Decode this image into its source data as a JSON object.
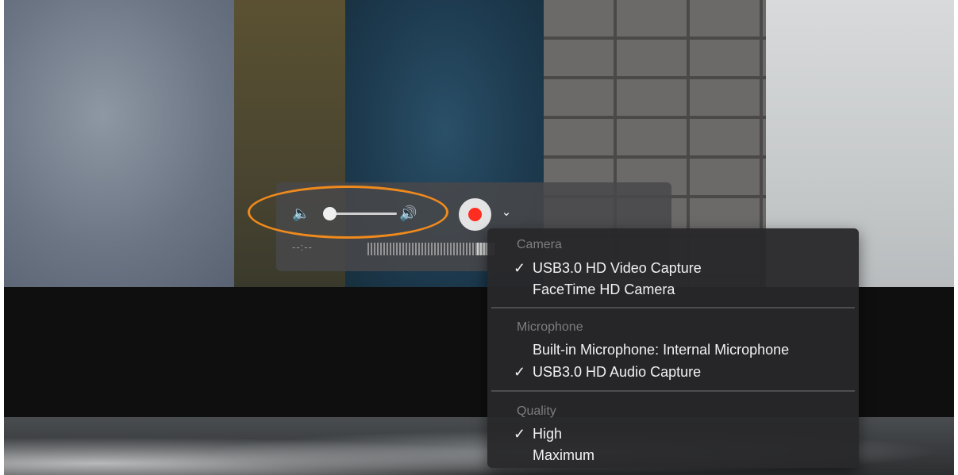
{
  "hud": {
    "volume_min_icon": "speaker-low-icon",
    "volume_max_icon": "speaker-high-icon",
    "volume_level": 0.0,
    "record_icon": "record-icon",
    "chevron_icon": "chevron-down-icon",
    "time_readout": "--:--"
  },
  "menu": {
    "sections": [
      {
        "header": "Camera",
        "items": [
          {
            "label": "USB3.0 HD Video Capture",
            "checked": true
          },
          {
            "label": "FaceTime HD Camera",
            "checked": false
          }
        ]
      },
      {
        "header": "Microphone",
        "items": [
          {
            "label": "Built-in Microphone: Internal Microphone",
            "checked": false
          },
          {
            "label": "USB3.0 HD Audio Capture",
            "checked": true
          }
        ]
      },
      {
        "header": "Quality",
        "items": [
          {
            "label": "High",
            "checked": true
          },
          {
            "label": "Maximum",
            "checked": false
          }
        ]
      }
    ],
    "check_glyph": "✓"
  },
  "colors": {
    "annotation": "#f08a1c",
    "record": "#ff2d1f"
  }
}
